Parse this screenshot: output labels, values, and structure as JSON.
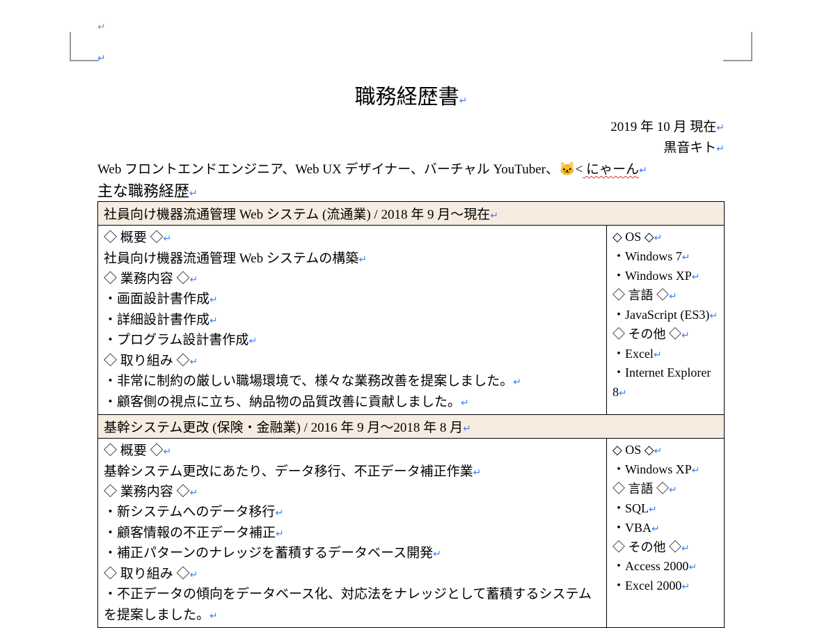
{
  "title": "職務経歴書",
  "date": "2019 年 10 月 現在",
  "name": "黒音キト",
  "intro_prefix": "Web フロントエンドエンジニア、Web UX デザイナー、バーチャル YouTuber、",
  "intro_cat": "🐱",
  "intro_lt": "<",
  "intro_wavy": " にゃーん",
  "section_heading": "主な職務経歴",
  "job1": {
    "header": "社員向け機器流通管理 Web システム (流通業) / 2018 年 9 月〜現在",
    "h_overview": "◇ 概要 ◇",
    "overview": "社員向け機器流通管理 Web システムの構築",
    "h_duties": "◇ 業務内容 ◇",
    "duty1": "・画面設計書作成",
    "duty2": "・詳細設計書作成",
    "duty3": "・プログラム設計書作成",
    "h_effort": "◇ 取り組み ◇",
    "effort1": "・非常に制約の厳しい職場環境で、様々な業務改善を提案しました。",
    "effort2": "・顧客側の視点に立ち、納品物の品質改善に貢献しました。",
    "h_os": "◇ OS ◇",
    "os1": "・Windows 7",
    "os2": "・Windows XP",
    "h_lang": "◇ 言語 ◇",
    "lang1": "・JavaScript (ES3)",
    "h_other": "◇ その他 ◇",
    "other1": "・Excel",
    "other2": "・Internet Explorer 8"
  },
  "job2": {
    "header": "基幹システム更改 (保険・金融業) / 2016 年 9 月〜2018 年 8 月",
    "h_overview": "◇ 概要 ◇",
    "overview": "基幹システム更改にあたり、データ移行、不正データ補正作業",
    "h_duties": "◇ 業務内容 ◇",
    "duty1": "・新システムへのデータ移行",
    "duty2": "・顧客情報の不正データ補正",
    "duty3": "・補正パターンのナレッジを蓄積するデータベース開発",
    "h_effort": "◇ 取り組み ◇",
    "effort1": "・不正データの傾向をデータベース化、対応法をナレッジとして蓄積するシステムを提案しました。",
    "h_os": "◇ OS ◇",
    "os1": "・Windows XP",
    "h_lang": "◇ 言語 ◇",
    "lang1": "・SQL",
    "lang2": "・VBA",
    "h_other": "◇ その他 ◇",
    "other1": "・Access 2000",
    "other2": "・Excel 2000"
  }
}
